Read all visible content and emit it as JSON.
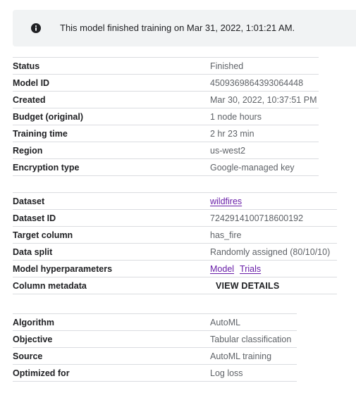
{
  "banner": {
    "icon": "info-icon",
    "message": "This model finished training on Mar 31, 2022, 1:01:21 AM."
  },
  "model_section": [
    {
      "label": "Status",
      "value": "Finished"
    },
    {
      "label": "Model ID",
      "value": "4509369864393064448"
    },
    {
      "label": "Created",
      "value": "Mar 30, 2022, 10:37:51 PM"
    },
    {
      "label": "Budget (original)",
      "value": "1 node hours"
    },
    {
      "label": "Training time",
      "value": "2 hr 23 min"
    },
    {
      "label": "Region",
      "value": "us-west2"
    },
    {
      "label": "Encryption type",
      "value": "Google-managed key"
    }
  ],
  "dataset_section": {
    "dataset": {
      "label": "Dataset",
      "value": "wildfires"
    },
    "dataset_id": {
      "label": "Dataset ID",
      "value": "7242914100718600192"
    },
    "target_column": {
      "label": "Target column",
      "value": "has_fire"
    },
    "data_split": {
      "label": "Data split",
      "value": "Randomly assigned (80/10/10)"
    },
    "hyperparameters": {
      "label": "Model hyperparameters",
      "model_link": "Model",
      "trials_link": "Trials"
    },
    "column_metadata": {
      "label": "Column metadata",
      "button": "VIEW DETAILS"
    }
  },
  "algorithm_section": [
    {
      "label": "Algorithm",
      "value": "AutoML"
    },
    {
      "label": "Objective",
      "value": "Tabular classification"
    },
    {
      "label": "Source",
      "value": "AutoML training"
    },
    {
      "label": "Optimized for",
      "value": "Log loss"
    }
  ],
  "colors": {
    "link": "#681da8",
    "banner_bg": "#f1f3f4",
    "divider": "#dadce0"
  }
}
